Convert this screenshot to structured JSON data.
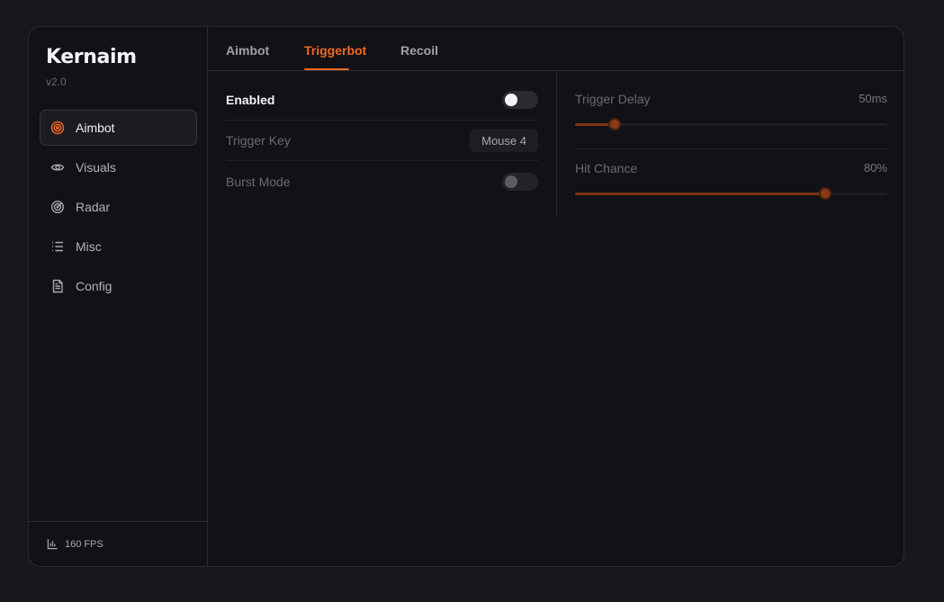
{
  "app": {
    "name": "Kernaim",
    "version": "v2.0",
    "accent": "#ee6a22"
  },
  "sidebar": {
    "items": [
      {
        "label": "Aimbot",
        "icon": "target-icon",
        "active": true
      },
      {
        "label": "Visuals",
        "icon": "eye-icon",
        "active": false
      },
      {
        "label": "Radar",
        "icon": "radar-icon",
        "active": false
      },
      {
        "label": "Misc",
        "icon": "list-icon",
        "active": false
      },
      {
        "label": "Config",
        "icon": "file-icon",
        "active": false
      }
    ],
    "footer": {
      "icon": "bar-chart-icon",
      "text": "160 FPS"
    }
  },
  "tabs": [
    {
      "label": "Aimbot",
      "active": false
    },
    {
      "label": "Triggerbot",
      "active": true
    },
    {
      "label": "Recoil",
      "active": false
    }
  ],
  "settings": {
    "enabled": {
      "label": "Enabled",
      "on": true
    },
    "trigger_key": {
      "label": "Trigger Key",
      "value": "Mouse 4"
    },
    "burst_mode": {
      "label": "Burst Mode",
      "on": false
    }
  },
  "sliders": {
    "trigger_delay": {
      "label": "Trigger Delay",
      "value": "50ms",
      "fraction": 0.127
    },
    "hit_chance": {
      "label": "Hit Chance",
      "value": "80%",
      "fraction": 0.8
    }
  }
}
